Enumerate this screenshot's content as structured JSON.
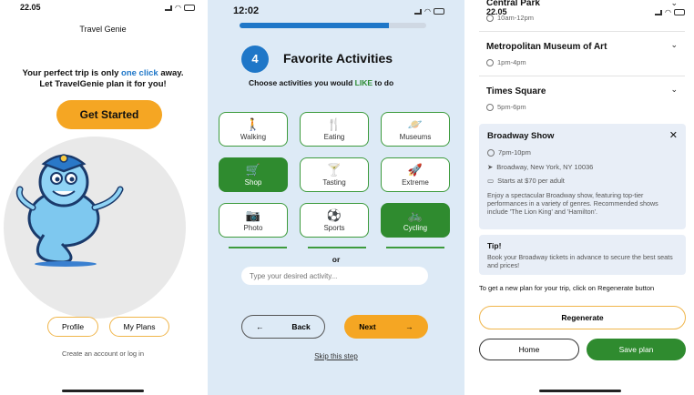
{
  "screen1": {
    "status_time": "22.05",
    "brand": "Travel Genie",
    "tagline_prefix": "Your perfect trip is only ",
    "tagline_highlight": "one click",
    "tagline_suffix": " away.",
    "tagline_line2": "Let TravelGenie plan it for you!",
    "get_started": "Get Started",
    "profile": "Profile",
    "my_plans": "My Plans",
    "create_account": "Create an account or log in",
    "mascot_icon": "genie-mascot-icon"
  },
  "screen2": {
    "status_time": "12:02",
    "progress_percent": 80,
    "step_number": "4",
    "step_title": "Favorite Activities",
    "subtitle_prefix": "Choose activities you would ",
    "subtitle_like": "LIKE",
    "subtitle_suffix": " to do",
    "activities": [
      {
        "label": "Walking",
        "icon": "🚶",
        "selected": false
      },
      {
        "label": "Eating",
        "icon": "🍴",
        "selected": false
      },
      {
        "label": "Museums",
        "icon": "🪐",
        "selected": false
      },
      {
        "label": "Shop",
        "icon": "🛒",
        "selected": true
      },
      {
        "label": "Tasting",
        "icon": "🍸",
        "selected": false
      },
      {
        "label": "Extreme",
        "icon": "🚀",
        "selected": false
      },
      {
        "label": "Photo",
        "icon": "📷",
        "selected": false
      },
      {
        "label": "Sports",
        "icon": "⚽",
        "selected": false
      },
      {
        "label": "Cycling",
        "icon": "🚲",
        "selected": true
      }
    ],
    "or": "or",
    "input_placeholder": "Type your desired activity...",
    "back": "Back",
    "next": "Next",
    "skip": "Skip this step"
  },
  "screen3": {
    "status_time": "22.05",
    "items": [
      {
        "title": "Central Park",
        "time": "10am-12pm"
      },
      {
        "title": "Metropolitan Museum of Art",
        "time": "1pm-4pm"
      },
      {
        "title": "Times Square",
        "time": "5pm-6pm"
      }
    ],
    "card": {
      "title": "Broadway Show",
      "time": "7pm-10pm",
      "address": "Broadway, New York, NY 10036",
      "price": "Starts at $70 per adult",
      "description": "Enjoy a spectacular Broadway show, featuring top-tier performances in a variety of genres. Recommended shows include 'The Lion King' and 'Hamilton'."
    },
    "tip": {
      "title": "Tip!",
      "text": "Book your Broadway tickets in advance to secure the best seats and prices!"
    },
    "note": "To get a new plan for your trip, click on Regenerate button",
    "regenerate": "Regenerate",
    "home": "Home",
    "save": "Save plan"
  },
  "colors": {
    "accent_orange": "#f5a623",
    "accent_blue": "#1f77c8",
    "accent_green": "#2f8b2f"
  }
}
